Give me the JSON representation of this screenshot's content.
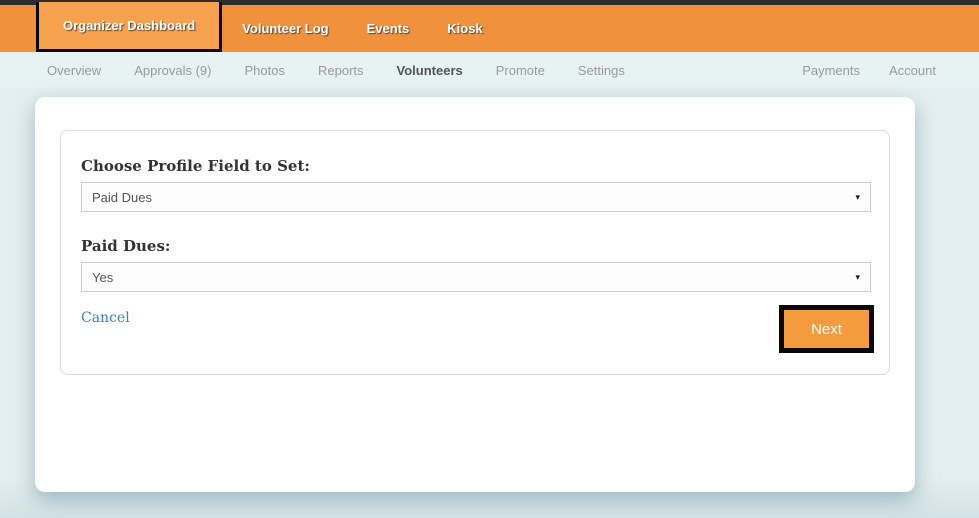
{
  "topnav": {
    "items": [
      {
        "label": "Organizer Dashboard",
        "active": true,
        "highlighted": true
      },
      {
        "label": "Volunteer Log",
        "active": false
      },
      {
        "label": "Events",
        "active": false
      },
      {
        "label": "Kiosk",
        "active": false
      }
    ]
  },
  "subnav": {
    "left_items": [
      {
        "label": "Overview",
        "active": false
      },
      {
        "label": "Approvals (9)",
        "active": false
      },
      {
        "label": "Photos",
        "active": false
      },
      {
        "label": "Reports",
        "active": false
      },
      {
        "label": "Volunteers",
        "active": true
      },
      {
        "label": "Promote",
        "active": false
      },
      {
        "label": "Settings",
        "active": false
      }
    ],
    "right_items": [
      {
        "label": "Payments"
      },
      {
        "label": "Account"
      }
    ]
  },
  "form": {
    "profile_field": {
      "label": "Choose Profile Field to Set:",
      "selected_value": "Paid Dues"
    },
    "paid_dues": {
      "label": "Paid Dues:",
      "selected_value": "Yes"
    },
    "cancel_label": "Cancel",
    "next_label": "Next"
  },
  "icons": {
    "dropdown_arrow": "▾"
  },
  "colors": {
    "nav_orange": "#f0913c",
    "active_tab_orange": "#f6a14e",
    "top_strip_dark": "#2d2d2d",
    "subnav_background": "#e7f2f3",
    "link_blue": "#2e86c1",
    "next_button_orange": "#f49b3e",
    "highlight_border_black": "#0a0a0a"
  }
}
